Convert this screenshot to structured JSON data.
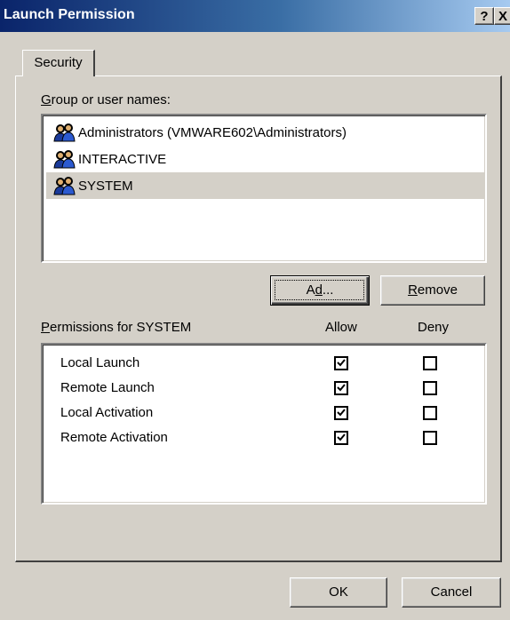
{
  "window": {
    "title": "Launch Permission",
    "help_button": "?",
    "close_button": "X"
  },
  "tabs": [
    {
      "label": "Security"
    }
  ],
  "groups": {
    "label": "Group or user names:",
    "label_accel": "G",
    "label_rest": "roup or user names:",
    "items": [
      {
        "name": "Administrators (VMWARE602\\Administrators)",
        "icon": "users-group-icon",
        "selected": false
      },
      {
        "name": "INTERACTIVE",
        "icon": "users-group-icon",
        "selected": false
      },
      {
        "name": "SYSTEM",
        "icon": "users-group-icon",
        "selected": true
      }
    ]
  },
  "buttons": {
    "add_pre": "A",
    "add_accel": "d",
    "add_post": "d...",
    "remove_accel": "R",
    "remove_rest": "emove",
    "ok": "OK",
    "cancel": "Cancel"
  },
  "permissions": {
    "label_accel": "P",
    "label_rest": "ermissions for SYSTEM",
    "allow_header": "Allow",
    "deny_header": "Deny",
    "rows": [
      {
        "name": "Local Launch",
        "allow": true,
        "deny": false
      },
      {
        "name": "Remote Launch",
        "allow": true,
        "deny": false
      },
      {
        "name": "Local Activation",
        "allow": true,
        "deny": false
      },
      {
        "name": "Remote Activation",
        "allow": true,
        "deny": false
      }
    ]
  },
  "colors": {
    "titlebar_start": "#0a246a",
    "titlebar_end": "#a6caf0",
    "face": "#d4d0c8",
    "selection": "#d4d0c8"
  }
}
